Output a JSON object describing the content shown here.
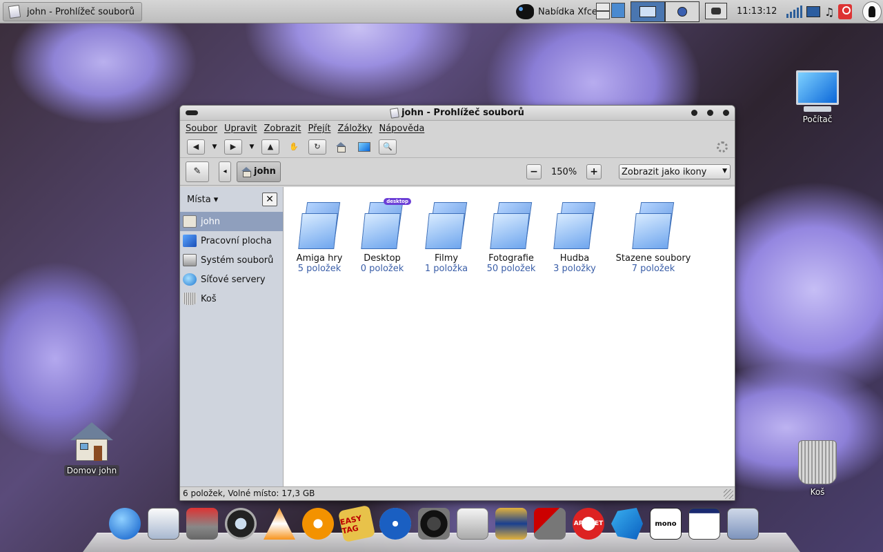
{
  "panel": {
    "task_title": "john - Prohlížeč souborů",
    "xfce_menu_label": "Nabídka Xfce",
    "clock": "11:13:12"
  },
  "desktop": {
    "computer_label": "Počítač",
    "home_label": "Domov john",
    "trash_label": "Koš"
  },
  "window": {
    "title": "john - Prohlížeč souborů",
    "menu": [
      "Soubor",
      "Upravit",
      "Zobrazit",
      "Přejít",
      "Záložky",
      "Nápověda"
    ],
    "location": {
      "current": "john",
      "zoom": "150%",
      "view_mode": "Zobrazit jako ikony"
    },
    "sidebar": {
      "header": "Místa",
      "items": [
        {
          "label": "john",
          "icon": "home-icon",
          "selected": true
        },
        {
          "label": "Pracovní plocha",
          "icon": "desktop-icon"
        },
        {
          "label": "Systém souborů",
          "icon": "filesystem-icon"
        },
        {
          "label": "Síťové servery",
          "icon": "network-icon"
        },
        {
          "label": "Koš",
          "icon": "trash-icon"
        }
      ]
    },
    "files": [
      {
        "name": "Amiga hry",
        "count": "5 položek"
      },
      {
        "name": "Desktop",
        "count": "0 položek",
        "emblem": "desktop"
      },
      {
        "name": "Filmy",
        "count": "1 položka"
      },
      {
        "name": "Fotografie",
        "count": "50 položek"
      },
      {
        "name": "Hudba",
        "count": "3 položky"
      },
      {
        "name": "Stazene soubory",
        "count": "7 položek"
      }
    ],
    "status": "6 položek, Volné místo: 17,3 GB"
  },
  "dock": {
    "easytag_label": "EASY TAG",
    "aptget_label": "APT GET",
    "mono_label": "mono"
  }
}
